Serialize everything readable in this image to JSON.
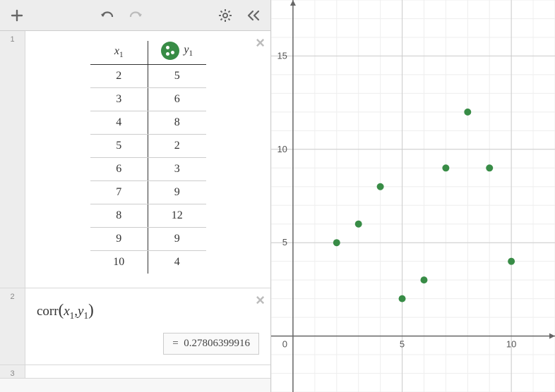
{
  "toolbar": {
    "add": "+",
    "undo": "undo",
    "redo": "redo",
    "settings": "settings",
    "collapse": "collapse"
  },
  "expressions": [
    {
      "index": "1",
      "type": "table",
      "columns": {
        "x": "x",
        "xsub": "1",
        "y": "y",
        "ysub": "1"
      },
      "rows": [
        {
          "x": "2",
          "y": "5"
        },
        {
          "x": "3",
          "y": "6"
        },
        {
          "x": "4",
          "y": "8"
        },
        {
          "x": "5",
          "y": "2"
        },
        {
          "x": "6",
          "y": "3"
        },
        {
          "x": "7",
          "y": "9"
        },
        {
          "x": "8",
          "y": "12"
        },
        {
          "x": "9",
          "y": "9"
        },
        {
          "x": "10",
          "y": "4"
        }
      ]
    },
    {
      "index": "2",
      "type": "expression",
      "formula_fn": "corr",
      "formula_arg1": "x",
      "formula_arg1_sub": "1",
      "formula_arg2": "y",
      "formula_arg2_sub": "1",
      "result_eq": "=",
      "result_value": "0.27806399916"
    },
    {
      "index": "3",
      "type": "empty"
    }
  ],
  "chart_data": {
    "type": "scatter",
    "x": [
      2,
      3,
      4,
      5,
      6,
      7,
      8,
      9,
      10
    ],
    "y": [
      5,
      6,
      8,
      2,
      3,
      9,
      12,
      9,
      4
    ],
    "xlabel": "",
    "ylabel": "",
    "xlim": [
      -1,
      12
    ],
    "ylim": [
      -3,
      18
    ],
    "xticks": [
      0,
      5,
      10
    ],
    "yticks": [
      0,
      5,
      10,
      15
    ],
    "point_color": "#388c46",
    "origin_label": "0"
  }
}
